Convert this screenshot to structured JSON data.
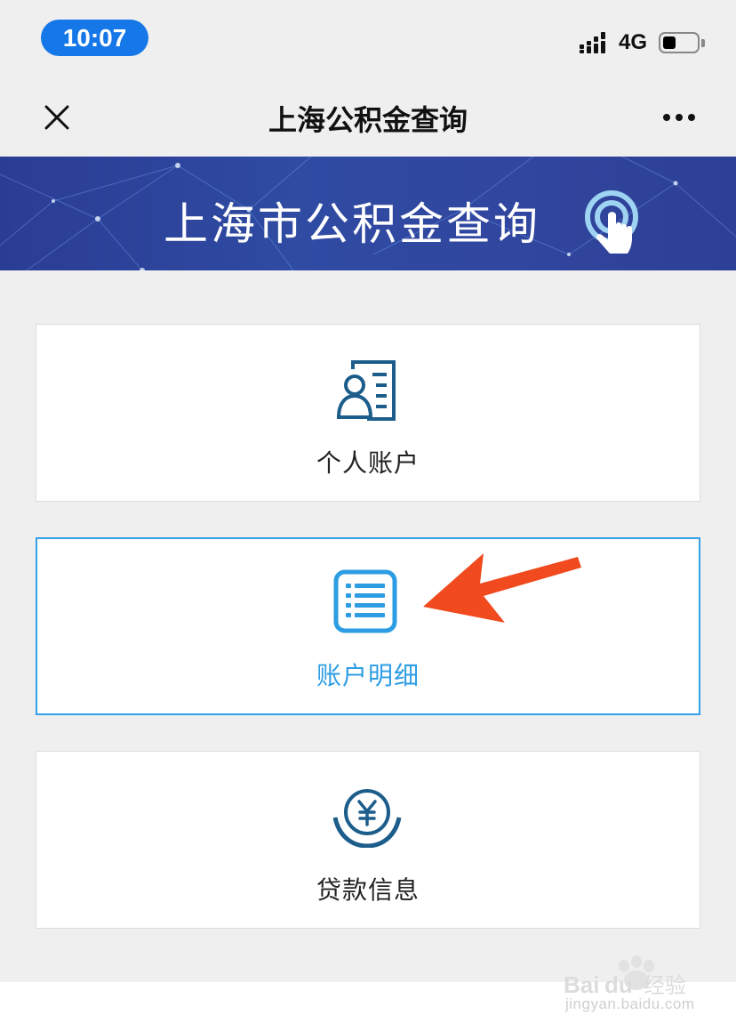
{
  "status_bar": {
    "time": "10:07",
    "network": "4G",
    "signal_icon": "signal-bars-icon",
    "battery_icon": "battery-icon",
    "battery_level": 0.35
  },
  "nav_bar": {
    "title": "上海公积金查询",
    "close_icon": "close-icon",
    "more_icon": "more-dots-icon"
  },
  "banner": {
    "title": "上海市公积金查询",
    "icon": "tap-hand-icon"
  },
  "cards": [
    {
      "label": "个人账户",
      "icon": "personal-account-icon",
      "selected": false
    },
    {
      "label": "账户明细",
      "icon": "list-details-icon",
      "selected": true
    },
    {
      "label": "贷款信息",
      "icon": "yuan-coin-icon",
      "selected": false
    }
  ],
  "colors": {
    "accent": "#2d9de3",
    "icon_dark": "#1d5d8c",
    "banner": "#2f4ba2",
    "arrow": "#f04a1e",
    "time_pill": "#1677e8"
  },
  "watermark": {
    "brand": "Baidu经验",
    "url": "jingyan.baidu.com"
  }
}
